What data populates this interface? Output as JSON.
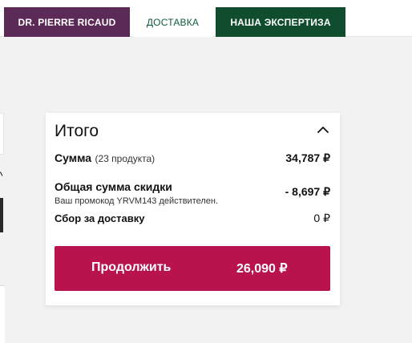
{
  "nav": {
    "tabs": [
      {
        "label": "DR. PIERRE RICAUD"
      },
      {
        "label": "ДОСТАВКА"
      },
      {
        "label": "НАША ЭКСПЕРТИЗА"
      }
    ]
  },
  "summary": {
    "title": "Итого",
    "collapse_icon": "chevron-up-icon",
    "subtotal": {
      "label": "Сумма",
      "count": "(23 продукта)",
      "value": "34,787 ₽"
    },
    "discount": {
      "label": "Общая сумма скидки",
      "note": "Ваш промокод YRVM143 действителен.",
      "value": "- 8,697 ₽"
    },
    "delivery": {
      "label": "Сбор за доставку",
      "value": "0 ₽"
    },
    "continue_button": {
      "label": "Продолжить",
      "total": "26,090 ₽"
    }
  },
  "colors": {
    "tab_pierre": "#5b2a57",
    "tab_expertise": "#0f4d2e",
    "tab_delivery_text": "#0f5a3a",
    "continue_button": "#b8124f"
  }
}
